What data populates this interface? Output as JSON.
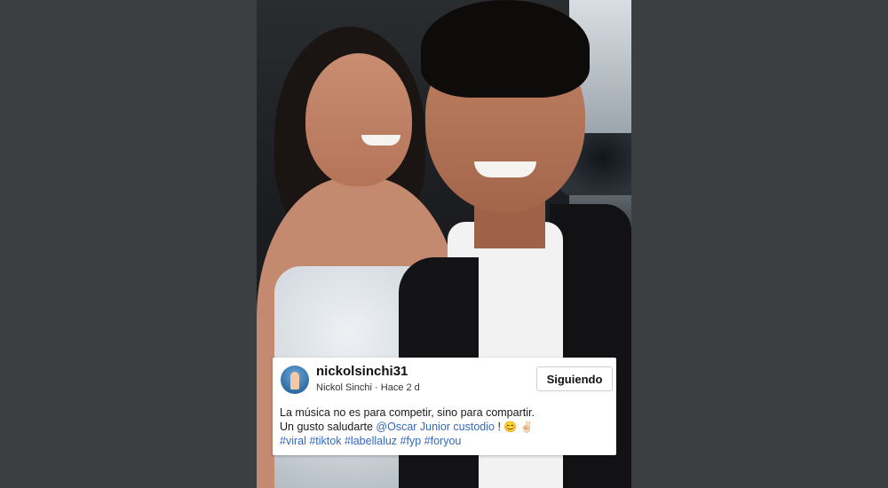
{
  "post": {
    "username": "nickolsinchi31",
    "display_name": "Nickol Sinchi",
    "separator": "·",
    "time_ago": "Hace 2 d",
    "follow_button": "Siguiendo",
    "caption_line1": "La música no es para competir, sino para compartir.",
    "caption_line2_prefix": "Un gusto saludarte ",
    "mention": "@Oscar Junior custodio",
    "caption_line2_suffix": " ! ",
    "emoji_1": "😊",
    "emoji_2": "✌🏻",
    "hashtags": [
      "#viral",
      "#tiktok",
      "#labellaluz",
      "#fyp",
      "#foryou"
    ]
  },
  "colors": {
    "page_background": "#3b3f42",
    "card_background": "#ffffff",
    "link": "#3468c0"
  },
  "icons": {
    "avatar": "profile-avatar"
  }
}
